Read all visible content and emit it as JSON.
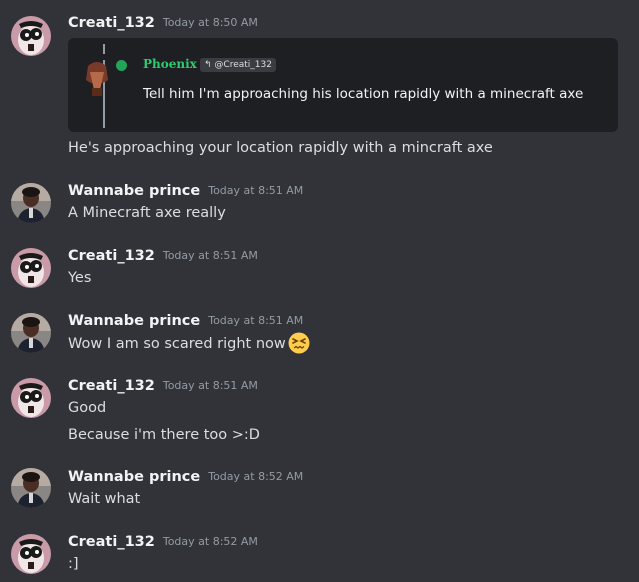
{
  "messages": [
    {
      "author": "Creati_132",
      "time": "Today at 8:50 AM",
      "embed": {
        "author": "Phoenix",
        "tag": "@Creati_132",
        "text": "Tell him I'm approaching his location rapidly with a minecraft axe"
      },
      "lines": [
        "He's approaching your location rapidly with a mincraft axe"
      ]
    },
    {
      "author": "Wannabe prince",
      "time": "Today at 8:51 AM",
      "lines": [
        "A Minecraft axe really"
      ]
    },
    {
      "author": "Creati_132",
      "time": "Today at 8:51 AM",
      "lines": [
        "Yes"
      ]
    },
    {
      "author": "Wannabe prince",
      "time": "Today at 8:51 AM",
      "lines": [
        "Wow I am so scared right now"
      ],
      "emoji": "persevering-face-emoji"
    },
    {
      "author": "Creati_132",
      "time": "Today at 8:51 AM",
      "lines": [
        "Good",
        "Because i'm there too >:D"
      ]
    },
    {
      "author": "Wannabe prince",
      "time": "Today at 8:52 AM",
      "lines": [
        "Wait what"
      ]
    },
    {
      "author": "Creati_132",
      "time": "Today at 8:52 AM",
      "lines": [
        ":]"
      ]
    }
  ],
  "colors": {
    "background": "#313338",
    "embed_background": "#1e1f22",
    "username": "#f2f3f5",
    "timestamp": "#949ba4",
    "embed_author": "#2ecc71",
    "online_dot": "#23a559"
  }
}
